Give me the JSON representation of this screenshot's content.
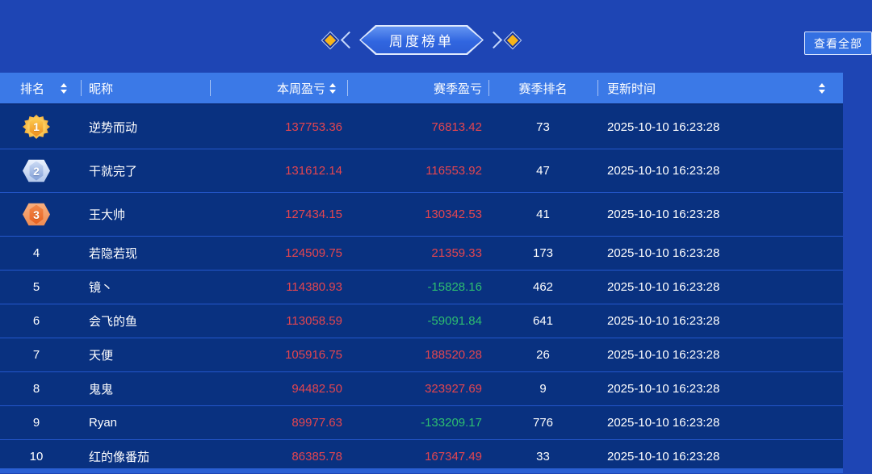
{
  "page": {
    "title": "周度榜单",
    "view_all_label": "查看全部"
  },
  "colors": {
    "background": "#1e45b4",
    "header_bg": "#3b79e7",
    "row_bg": "#093180",
    "positive_red": "#e4454f",
    "negative_green": "#2dbe70",
    "gold": "#f3a72e",
    "silver": "#aec4ea",
    "bronze": "#ef8a50"
  },
  "table": {
    "columns": [
      {
        "key": "rank",
        "label": "排名",
        "sortable": true
      },
      {
        "key": "nickname",
        "label": "昵称",
        "sortable": false
      },
      {
        "key": "week_pnl",
        "label": "本周盈亏",
        "sortable": true
      },
      {
        "key": "season_pnl",
        "label": "赛季盈亏",
        "sortable": false
      },
      {
        "key": "season_rank",
        "label": "赛季排名",
        "sortable": false
      },
      {
        "key": "update_time",
        "label": "更新时间",
        "sortable": true
      }
    ],
    "rows": [
      {
        "rank": "1",
        "medal": "gold",
        "nickname": "逆势而动",
        "week_pnl": "137753.36",
        "season_pnl": "76813.42",
        "season_rank": "73",
        "update_time": "2025-10-10 16:23:28"
      },
      {
        "rank": "2",
        "medal": "silver",
        "nickname": "干就完了",
        "week_pnl": "131612.14",
        "season_pnl": "116553.92",
        "season_rank": "47",
        "update_time": "2025-10-10 16:23:28"
      },
      {
        "rank": "3",
        "medal": "bronze",
        "nickname": "王大帅",
        "week_pnl": "127434.15",
        "season_pnl": "130342.53",
        "season_rank": "41",
        "update_time": "2025-10-10 16:23:28"
      },
      {
        "rank": "4",
        "medal": null,
        "nickname": "若隐若现",
        "week_pnl": "124509.75",
        "season_pnl": "21359.33",
        "season_rank": "173",
        "update_time": "2025-10-10 16:23:28"
      },
      {
        "rank": "5",
        "medal": null,
        "nickname": "镜丶",
        "week_pnl": "114380.93",
        "season_pnl": "-15828.16",
        "season_rank": "462",
        "update_time": "2025-10-10 16:23:28"
      },
      {
        "rank": "6",
        "medal": null,
        "nickname": "会飞的鱼",
        "week_pnl": "113058.59",
        "season_pnl": "-59091.84",
        "season_rank": "641",
        "update_time": "2025-10-10 16:23:28"
      },
      {
        "rank": "7",
        "medal": null,
        "nickname": "天便",
        "week_pnl": "105916.75",
        "season_pnl": "188520.28",
        "season_rank": "26",
        "update_time": "2025-10-10 16:23:28"
      },
      {
        "rank": "8",
        "medal": null,
        "nickname": "鬼鬼",
        "week_pnl": "94482.50",
        "season_pnl": "323927.69",
        "season_rank": "9",
        "update_time": "2025-10-10 16:23:28"
      },
      {
        "rank": "9",
        "medal": null,
        "nickname": "Ryan",
        "week_pnl": "89977.63",
        "season_pnl": "-133209.17",
        "season_rank": "776",
        "update_time": "2025-10-10 16:23:28"
      },
      {
        "rank": "10",
        "medal": null,
        "nickname": "红的像番茄",
        "week_pnl": "86385.78",
        "season_pnl": "167347.49",
        "season_rank": "33",
        "update_time": "2025-10-10 16:23:28"
      }
    ]
  }
}
